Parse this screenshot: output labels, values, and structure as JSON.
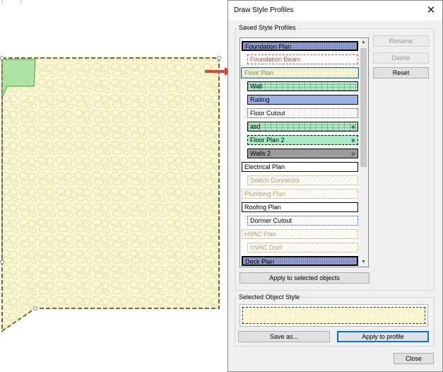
{
  "dialog": {
    "title": "Draw Style Profiles",
    "saved_group_label": "Saved Style Profiles",
    "selected_group_label": "Selected Object Style"
  },
  "profiles": [
    {
      "label": "Foundation Plan",
      "indent": 0,
      "border_color": "#000000",
      "border_style": "solid",
      "fill": "#9aa8d8",
      "pattern": "dots",
      "text_color": "#000000",
      "person": false,
      "selected": true
    },
    {
      "label": "Foundation Beam",
      "indent": 1,
      "border_color": "#c0504d",
      "border_style": "dashed",
      "fill": "#ffffff",
      "pattern": "none",
      "text_color": "#c0504d",
      "person": false,
      "selected": false
    },
    {
      "label": "Floor Plan",
      "indent": 0,
      "border_color": "#9aaecf",
      "border_style": "dotted",
      "fill": "#fbf7d2",
      "pattern": "stones",
      "text_color": "#7b7b7b",
      "person": false,
      "selected": false,
      "focused": true
    },
    {
      "label": "Wall",
      "indent": 1,
      "border_color": "#000000",
      "border_style": "solid",
      "fill": "#a9ecc4",
      "pattern": "bricks",
      "text_color": "#000000",
      "person": false,
      "selected": false
    },
    {
      "label": "Railing",
      "indent": 1,
      "border_color": "#000000",
      "border_style": "solid",
      "fill": "#9bb2e4",
      "pattern": "none",
      "text_color": "#000000",
      "person": false,
      "selected": false
    },
    {
      "label": "Floor Cutout",
      "indent": 1,
      "border_color": "#333333",
      "border_style": "dotted",
      "fill": "#ffffff",
      "pattern": "none",
      "text_color": "#000000",
      "person": false,
      "selected": false
    },
    {
      "label": "asd",
      "indent": 1,
      "border_color": "#000000",
      "border_style": "solid",
      "fill": "#a9ecc4",
      "pattern": "bricks",
      "text_color": "#000000",
      "person": true,
      "selected": false
    },
    {
      "label": "Floor Plan 2",
      "indent": 1,
      "border_color": "#000000",
      "border_style": "dashed",
      "fill": "#a9ecc4",
      "pattern": "none",
      "text_color": "#000000",
      "person": true,
      "selected": false
    },
    {
      "label": "Walls 2",
      "indent": 1,
      "border_color": "#000000",
      "border_style": "solid",
      "fill": "#9c9c9c",
      "pattern": "none",
      "text_color": "#000000",
      "person": true,
      "selected": false
    },
    {
      "label": "Electrical Plan",
      "indent": 0,
      "border_color": "#000000",
      "border_style": "solid",
      "fill": "#ffffff",
      "pattern": "none",
      "text_color": "#000000",
      "person": false,
      "selected": false
    },
    {
      "label": "Switch Connector",
      "indent": 1,
      "border_color": "#d9c9a0",
      "border_style": "solid",
      "fill": "#ffffff",
      "pattern": "hatch",
      "text_color": "#b3a070",
      "person": false,
      "selected": false
    },
    {
      "label": "Plumbing Plan",
      "indent": 0,
      "border_color": "#d9c9a0",
      "border_style": "solid",
      "fill": "#ffffff",
      "pattern": "hatch",
      "text_color": "#b3a070",
      "person": false,
      "selected": false
    },
    {
      "label": "Roofing Plan",
      "indent": 0,
      "border_color": "#000000",
      "border_style": "solid",
      "fill": "#ffffff",
      "pattern": "none",
      "text_color": "#000000",
      "person": false,
      "selected": false
    },
    {
      "label": "Dormer Cutout",
      "indent": 1,
      "border_color": "#3a4a9a",
      "border_style": "dotted",
      "fill": "#ffffff",
      "pattern": "none",
      "text_color": "#000000",
      "person": false,
      "selected": false
    },
    {
      "label": "HVAC Plan",
      "indent": 0,
      "border_color": "#d9c9a0",
      "border_style": "solid",
      "fill": "#ffffff",
      "pattern": "hatch",
      "text_color": "#b3a070",
      "person": false,
      "selected": false
    },
    {
      "label": "HVAC Duct",
      "indent": 1,
      "border_color": "#d9c9a0",
      "border_style": "solid",
      "fill": "#ffffff",
      "pattern": "hatch",
      "text_color": "#b3a070",
      "person": false,
      "selected": false
    },
    {
      "label": "Deck Plan",
      "indent": 0,
      "border_color": "#000000",
      "border_style": "solid",
      "fill": "#9aa8d8",
      "pattern": "dots",
      "text_color": "#000000",
      "person": false,
      "selected": true
    }
  ],
  "buttons": {
    "rename": "Rename",
    "delete": "Delete",
    "reset": "Reset",
    "apply_selected": "Apply to selected objects",
    "save_as": "Save as...",
    "apply_profile": "Apply to profile",
    "close": "Close"
  },
  "icons": {
    "close": "close-icon",
    "scroll_up": "scroll-up-icon",
    "scroll_down": "scroll-down-icon",
    "person": "person-icon",
    "arrow": "red-arrow-icon"
  },
  "colors": {
    "canvas_fill": "#fbf7d2",
    "canvas_border": "#c8a82a",
    "green_shape": "#9bdf9b",
    "arrow": "#e0443a",
    "focus": "#0078d7"
  }
}
